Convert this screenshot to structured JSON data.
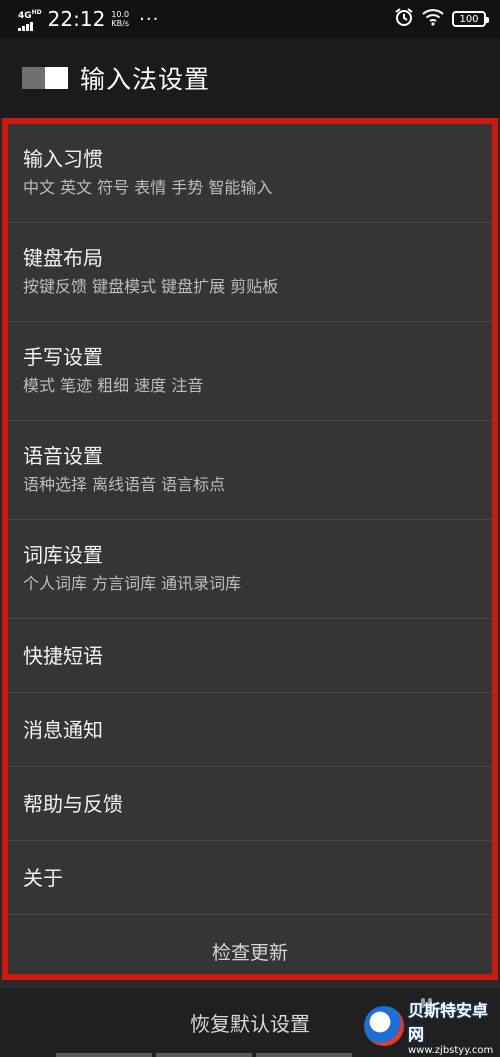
{
  "status_bar": {
    "network": "4G",
    "network_sup": "HD",
    "time": "22:12",
    "speed_value": "10.0",
    "speed_unit": "KB/s",
    "more": "···",
    "battery": "100",
    "icons": [
      "alarm-icon",
      "wifi-icon",
      "battery-icon"
    ]
  },
  "header": {
    "title": "输入法设置"
  },
  "menu": [
    {
      "title": "输入习惯",
      "subtitle": "中文 英文 符号 表情 手势 智能输入"
    },
    {
      "title": "键盘布局",
      "subtitle": "按键反馈 键盘模式 键盘扩展 剪贴板"
    },
    {
      "title": "手写设置",
      "subtitle": "模式 笔迹 粗细 速度 注音"
    },
    {
      "title": "语音设置",
      "subtitle": "语种选择 离线语音 语言标点"
    },
    {
      "title": "词库设置",
      "subtitle": "个人词库 方言词库 通讯录词库"
    },
    {
      "title": "快捷短语"
    },
    {
      "title": "消息通知"
    },
    {
      "title": "帮助与反馈"
    },
    {
      "title": "关于"
    }
  ],
  "check_update": "检查更新",
  "restore_default": "恢复默认设置",
  "watermark": {
    "name": "贝斯特安卓网",
    "url": "www.zjbstyy.com"
  },
  "colors": {
    "highlight_border": "#cc1a12",
    "list_background": "#353535",
    "header_background": "#1b1b1b"
  }
}
